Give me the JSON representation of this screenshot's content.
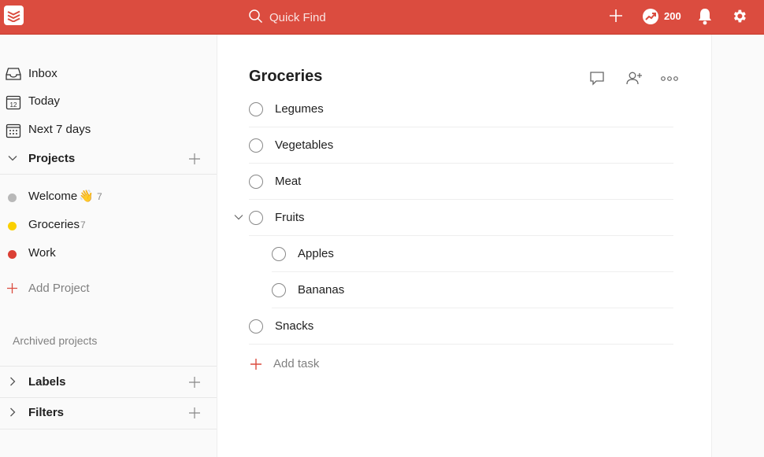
{
  "topbar": {
    "search_placeholder": "Quick Find",
    "karma_points": "200",
    "accent": "#db4c3f"
  },
  "sidebar": {
    "nav": [
      {
        "label": "Inbox",
        "icon": "inbox-icon"
      },
      {
        "label": "Today",
        "icon": "calendar-today-icon",
        "day": "12"
      },
      {
        "label": "Next 7 days",
        "icon": "calendar-week-icon"
      }
    ],
    "projects_header": "Projects",
    "projects": [
      {
        "label": "Welcome",
        "emoji": "👋",
        "count": "7",
        "color": "#b8b8b8"
      },
      {
        "label": "Groceries",
        "count": "7",
        "color": "#fad000"
      },
      {
        "label": "Work",
        "count": "",
        "color": "#db4035"
      }
    ],
    "add_project": "Add Project",
    "archived": "Archived projects",
    "labels_header": "Labels",
    "filters_header": "Filters"
  },
  "main": {
    "title": "Groceries",
    "tasks": [
      {
        "label": "Legumes"
      },
      {
        "label": "Vegetables"
      },
      {
        "label": "Meat"
      },
      {
        "label": "Fruits"
      },
      {
        "label": "Apples"
      },
      {
        "label": "Bananas"
      },
      {
        "label": "Snacks"
      }
    ],
    "add_task": "Add task"
  }
}
